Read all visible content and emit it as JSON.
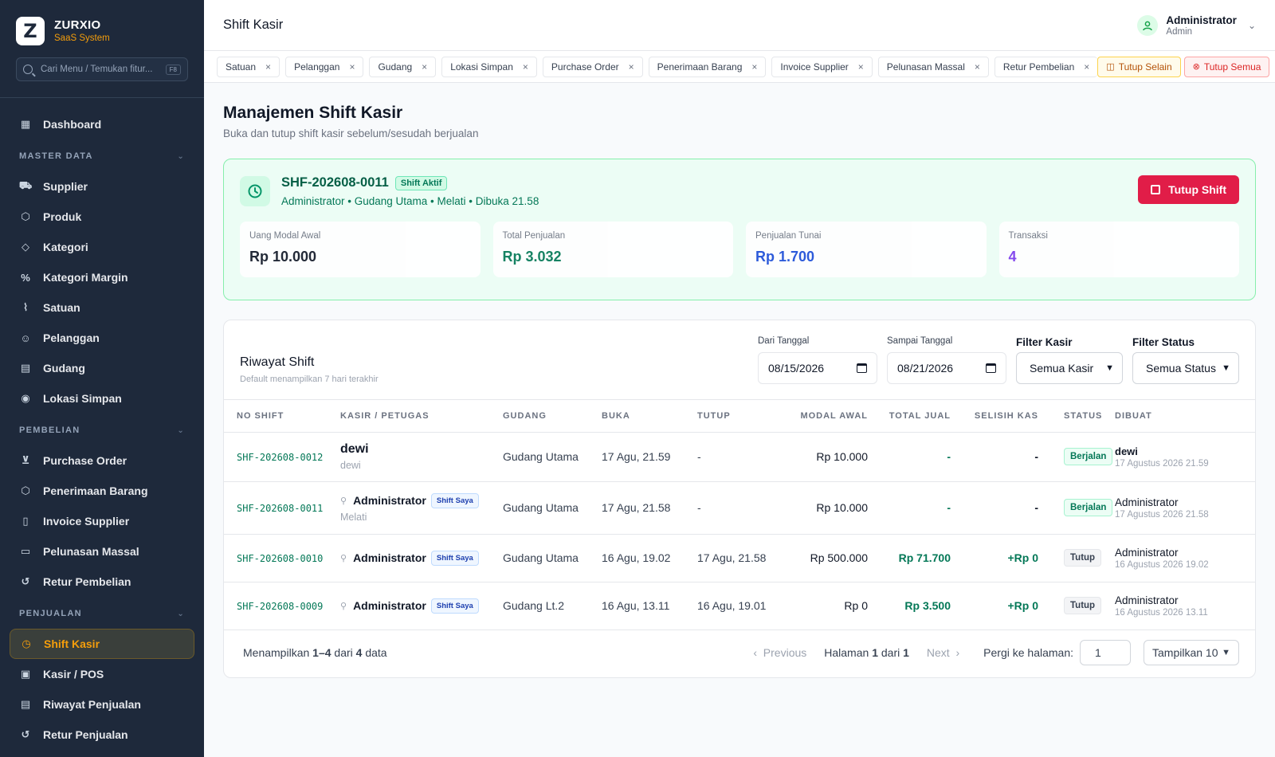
{
  "brand": {
    "logo": "Z",
    "name": "ZURXIO",
    "sub": "SaaS System"
  },
  "search": {
    "placeholder": "Cari Menu / Temukan fitur...",
    "shortcut": "F8"
  },
  "sidebar": {
    "dashboard": {
      "label": "Dashboard",
      "icon": "grid-icon"
    },
    "sections": [
      {
        "title": "MASTER DATA",
        "items": [
          {
            "label": "Supplier",
            "icon": "truck-icon"
          },
          {
            "label": "Produk",
            "icon": "box-icon"
          },
          {
            "label": "Kategori",
            "icon": "tag-icon"
          },
          {
            "label": "Kategori Margin",
            "icon": "percent-icon"
          },
          {
            "label": "Satuan",
            "icon": "ruler-icon"
          },
          {
            "label": "Pelanggan",
            "icon": "users-icon"
          },
          {
            "label": "Gudang",
            "icon": "warehouse-icon"
          },
          {
            "label": "Lokasi Simpan",
            "icon": "pin-icon"
          }
        ]
      },
      {
        "title": "PEMBELIAN",
        "items": [
          {
            "label": "Purchase Order",
            "icon": "cart-icon"
          },
          {
            "label": "Penerimaan Barang",
            "icon": "package-icon"
          },
          {
            "label": "Invoice Supplier",
            "icon": "file-icon"
          },
          {
            "label": "Pelunasan Massal",
            "icon": "wallet-icon"
          },
          {
            "label": "Retur Pembelian",
            "icon": "undo-icon"
          }
        ]
      },
      {
        "title": "PENJUALAN",
        "items": [
          {
            "label": "Shift Kasir",
            "icon": "clock-icon",
            "active": true
          },
          {
            "label": "Kasir / POS",
            "icon": "register-icon"
          },
          {
            "label": "Riwayat Penjualan",
            "icon": "clipboard-icon"
          },
          {
            "label": "Retur Penjualan",
            "icon": "undo-icon"
          }
        ]
      }
    ]
  },
  "topbar": {
    "title": "Shift Kasir",
    "user_name": "Administrator",
    "user_role": "Admin"
  },
  "tabs": [
    "Satuan",
    "Pelanggan",
    "Gudang",
    "Lokasi Simpan",
    "Purchase Order",
    "Penerimaan Barang",
    "Invoice Supplier",
    "Pelunasan Massal",
    "Retur Pembelian"
  ],
  "tab_actions": {
    "close_others": "Tutup Selain",
    "close_all": "Tutup Semua"
  },
  "page": {
    "title": "Manajemen Shift Kasir",
    "subtitle": "Buka dan tutup shift kasir sebelum/sesudah berjualan"
  },
  "active_shift": {
    "id": "SHF-202608-0011",
    "badge": "Shift Aktif",
    "meta": "Administrator • Gudang Utama • Melati • Dibuka 21.58",
    "close_button": "Tutup Shift",
    "stats": [
      {
        "label": "Uang Modal Awal",
        "value": "Rp 10.000",
        "color": "#111827"
      },
      {
        "label": "Total Penjualan",
        "value": "Rp 3.032",
        "color": "#047857"
      },
      {
        "label": "Penjualan Tunai",
        "value": "Rp 1.700",
        "color": "#1d4ed8"
      },
      {
        "label": "Transaksi",
        "value": "4",
        "color": "#7c3aed"
      }
    ]
  },
  "history": {
    "title": "Riwayat Shift",
    "subtitle": "Default menampilkan 7 hari terakhir",
    "filters": {
      "from_label": "Dari Tanggal",
      "from_value": "08/15/2026",
      "to_label": "Sampai Tanggal",
      "to_value": "08/21/2026",
      "kasir_label": "Filter Kasir",
      "kasir_value": "Semua Kasir",
      "status_label": "Filter Status",
      "status_value": "Semua Status"
    },
    "columns": [
      "NO SHIFT",
      "KASIR / PETUGAS",
      "GUDANG",
      "BUKA",
      "TUTUP",
      "MODAL AWAL",
      "TOTAL JUAL",
      "SELISIH KAS",
      "STATUS",
      "DIBUAT"
    ],
    "rows": [
      {
        "no": "SHF-202608-0012",
        "kasir": "dewi",
        "petugas": "dewi",
        "shift_saya": "",
        "gudang": "Gudang Utama",
        "buka": "17 Agu, 21.59",
        "tutup": "-",
        "modal": "Rp 10.000",
        "total": "-",
        "selisih": "-",
        "status": "Berjalan",
        "dibuat_by": "dewi",
        "dibuat_at": "17 Agustus 2026 21.59"
      },
      {
        "no": "SHF-202608-0011",
        "kasir": "Administrator",
        "petugas": "Melati",
        "shift_saya": "Shift Saya",
        "gudang": "Gudang Utama",
        "buka": "17 Agu, 21.58",
        "tutup": "-",
        "modal": "Rp 10.000",
        "total": "-",
        "selisih": "-",
        "status": "Berjalan",
        "dibuat_by": "Administrator",
        "dibuat_at": "17 Agustus 2026 21.58"
      },
      {
        "no": "SHF-202608-0010",
        "kasir": "Administrator",
        "petugas": "",
        "shift_saya": "Shift Saya",
        "gudang": "Gudang Utama",
        "buka": "16 Agu, 19.02",
        "tutup": "17 Agu, 21.58",
        "modal": "Rp 500.000",
        "total": "Rp 71.700",
        "selisih": "+Rp 0",
        "status": "Tutup",
        "dibuat_by": "Administrator",
        "dibuat_at": "16 Agustus 2026 19.02"
      },
      {
        "no": "SHF-202608-0009",
        "kasir": "Administrator",
        "petugas": "",
        "shift_saya": "Shift Saya",
        "gudang": "Gudang Lt.2",
        "buka": "16 Agu, 13.11",
        "tutup": "16 Agu, 19.01",
        "modal": "Rp 0",
        "total": "Rp 3.500",
        "selisih": "+Rp 0",
        "status": "Tutup",
        "dibuat_by": "Administrator",
        "dibuat_at": "16 Agustus 2026 13.11"
      }
    ],
    "footer": {
      "showing_prefix": "Menampilkan ",
      "showing_range": "1–4",
      "showing_mid": " dari ",
      "showing_total": "4",
      "showing_suffix": " data",
      "prev": "Previous",
      "page_prefix": "Halaman ",
      "page_current": "1",
      "page_mid": " dari ",
      "page_total": "1",
      "next": "Next",
      "goto_label": "Pergi ke halaman:",
      "goto_value": "1",
      "per_page": "Tampilkan 10"
    }
  }
}
